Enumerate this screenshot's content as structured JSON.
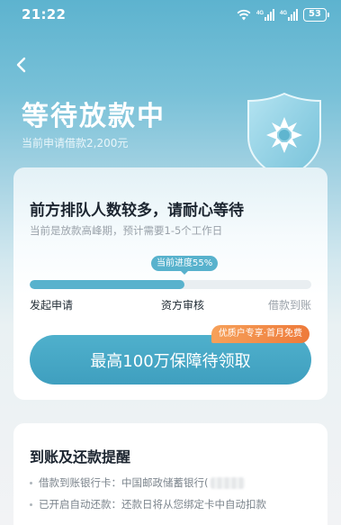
{
  "status_bar": {
    "time": "21:22",
    "network_1": "4G",
    "network_2": "4G",
    "battery": "53"
  },
  "header": {
    "back_icon": "chevron-left-icon",
    "title": "等待放款中",
    "loan_amount_text": "当前申请借款2,200元",
    "shield_icon": "shield-logo-icon"
  },
  "progress_card": {
    "title": "前方排队人数较多，请耐心等待",
    "subtitle": "当前是放款高峰期，预计需要1-5个工作日",
    "progress_label": "当前进度55%",
    "progress_percent": 55,
    "steps": [
      "发起申请",
      "资方审核",
      "借款到账"
    ],
    "cta_label": "最高100万保障待领取",
    "cta_tag": "优质户专享·首月免费"
  },
  "reminder_card": {
    "title": "到账及还款提醒",
    "items": [
      "借款到账银行卡：中国邮政储蓄银行(",
      "已开启自动还款：还款日将从您绑定卡中自动扣款"
    ]
  },
  "colors": {
    "accent": "#58b2cd",
    "tag_orange": "#ee7a3a"
  }
}
